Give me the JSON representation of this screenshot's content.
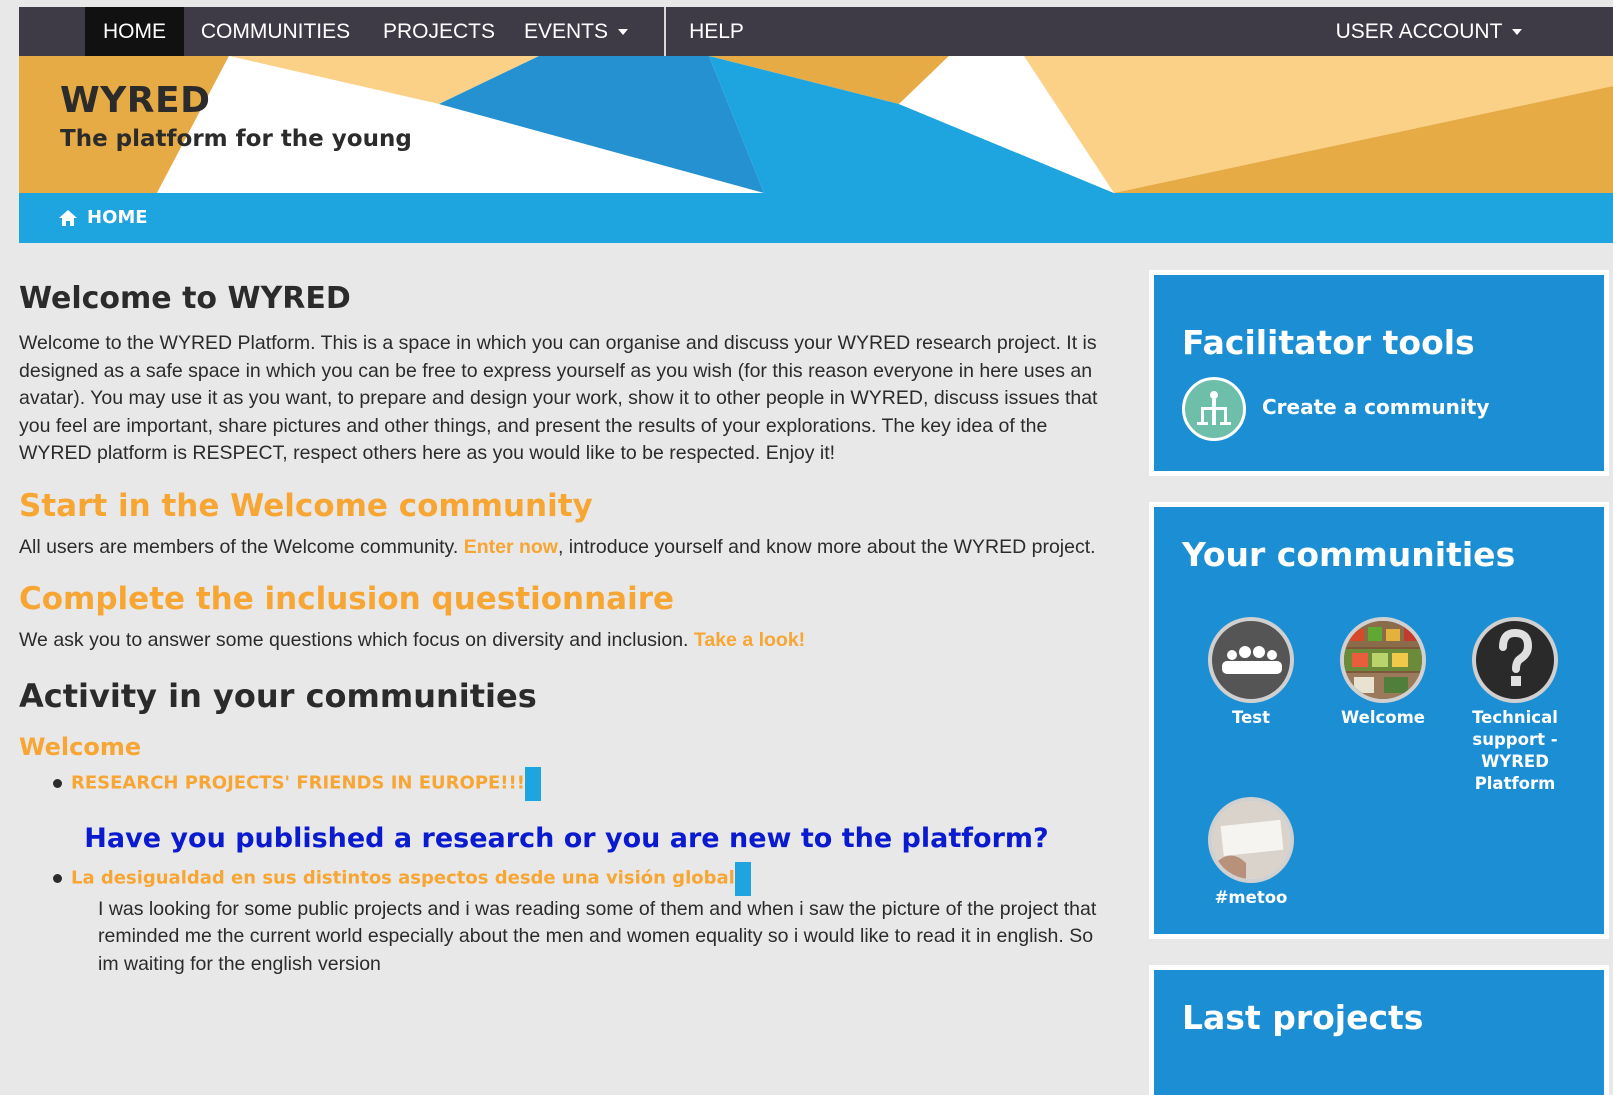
{
  "nav": {
    "items": [
      {
        "label": "HOME",
        "active": true
      },
      {
        "label": "COMMUNITIES"
      },
      {
        "label": "PROJECTS"
      },
      {
        "label": "EVENTS",
        "has_caret": true
      },
      {
        "label": "HELP"
      }
    ],
    "account_label": "USER ACCOUNT"
  },
  "banner": {
    "title": "WYRED",
    "subtitle": "The platform for the young"
  },
  "breadcrumb": {
    "home_label": "HOME",
    "icon": "home-icon"
  },
  "main": {
    "welcome_title": "Welcome to WYRED",
    "welcome_text": "Welcome to the WYRED Platform. This is a space in which you can organise and discuss your WYRED research project. It is designed as a safe space in which you can be free to express yourself as you wish (for this reason everyone in here uses an avatar). You may use it as you want, to prepare and design your work, show it to other people in WYRED, discuss issues that you feel are important, share pictures and other things, and present the results of your explorations. The key idea of the WYRED platform is RESPECT, respect others here as you would like to be respected. Enjoy it!",
    "start_heading": "Start in the Welcome community",
    "start_text_before": "All users are members of the Welcome community. ",
    "start_link": "Enter now",
    "start_text_after": ", introduce yourself and know more about the WYRED project.",
    "questionnaire_heading": "Complete the inclusion questionnaire",
    "questionnaire_text": "We ask you to answer some questions which focus on diversity and inclusion. ",
    "questionnaire_link": "Take a look!",
    "activity_heading": "Activity in your communities",
    "activity_community": "Welcome",
    "posts": [
      {
        "title": "RESEARCH PROJECTS' FRIENDS IN EUROPE!!!",
        "callout": "Have you published a research or you are new to the platform?"
      },
      {
        "title": "La desigualdad en sus distintos aspectos desde una visión global",
        "body": "I was looking for some public projects and i was reading some of them and when i saw the picture of the project that reminded me the current world especially about the men and women equality so i would like to read it in english. So im waiting for the english version"
      }
    ]
  },
  "sidebar": {
    "facilitator_title": "Facilitator tools",
    "create_community_label": "Create a community",
    "communities_title": "Your communities",
    "communities": [
      {
        "label": "Test",
        "icon": "group-icon"
      },
      {
        "label": "Welcome",
        "icon": "market-photo"
      },
      {
        "label": "Technical support - WYRED Platform",
        "icon": "question-icon"
      },
      {
        "label": "#metoo",
        "icon": "metoo-photo"
      }
    ],
    "last_projects_title": "Last projects"
  },
  "colors": {
    "nav_bg": "#3f3b46",
    "accent_blue": "#1ea5e0",
    "panel_blue": "#1c8fd4",
    "orange": "#f7a533",
    "callout_blue": "#0a1acf"
  }
}
